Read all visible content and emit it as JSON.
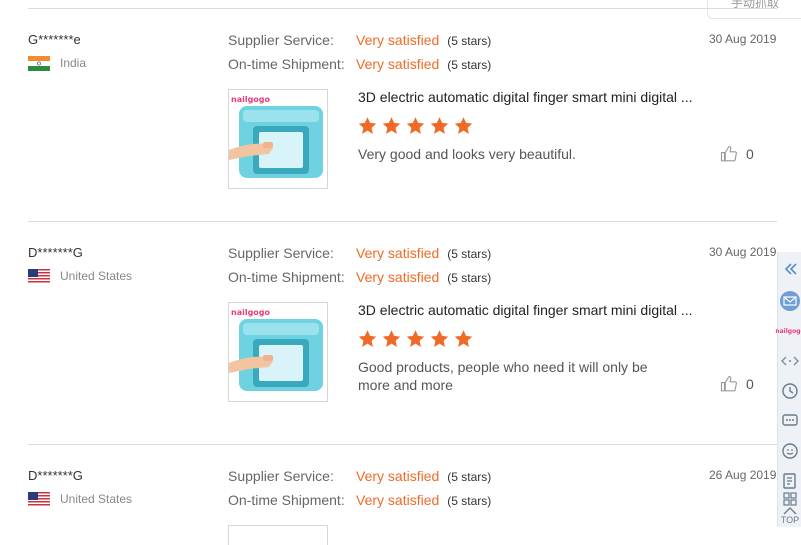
{
  "top_button": {
    "label": "手动抓取"
  },
  "reviews": [
    {
      "user": "G*******e",
      "country": "India",
      "flag": "india",
      "supplier_label": "Supplier Service:",
      "supplier_value": "Very satisfied",
      "supplier_stars": "(5 stars)",
      "shipment_label": "On-time Shipment:",
      "shipment_value": "Very satisfied",
      "shipment_stars": "(5 stars)",
      "date": "30 Aug 2019",
      "product_title": "3D electric automatic digital finger smart mini digital ...",
      "rating": 5,
      "comment": "Very good and looks very beautiful.",
      "likes": "0",
      "brand": "nailgogo"
    },
    {
      "user": "D*******G",
      "country": "United States",
      "flag": "us",
      "supplier_label": "Supplier Service:",
      "supplier_value": "Very satisfied",
      "supplier_stars": "(5 stars)",
      "shipment_label": "On-time Shipment:",
      "shipment_value": "Very satisfied",
      "shipment_stars": "(5 stars)",
      "date": "30 Aug 2019",
      "product_title": "3D electric automatic digital finger smart mini digital ...",
      "rating": 5,
      "comment": "Good products, people who need it will only be more and more",
      "likes": "0",
      "brand": "nailgogo"
    },
    {
      "user": "D*******G",
      "country": "United States",
      "flag": "us",
      "supplier_label": "Supplier Service:",
      "supplier_value": "Very satisfied",
      "supplier_stars": "(5 stars)",
      "shipment_label": "On-time Shipment:",
      "shipment_value": "Very satisfied",
      "shipment_stars": "(5 stars)",
      "date": "26 Aug 2019"
    }
  ],
  "sidebar": {
    "brand": "nailgogo",
    "top_label": "TOP",
    "icons": [
      "collapse-icon",
      "mail-icon",
      "brand-logo",
      "share-icon",
      "clock-icon",
      "chat-icon",
      "face-icon",
      "edit-icon",
      "grid-icon",
      "top-icon"
    ]
  },
  "colors": {
    "accent": "#f06a26",
    "divider": "#dcdcdc",
    "sidebar_bg": "#eef2f7",
    "device": "#6fd2e0"
  }
}
